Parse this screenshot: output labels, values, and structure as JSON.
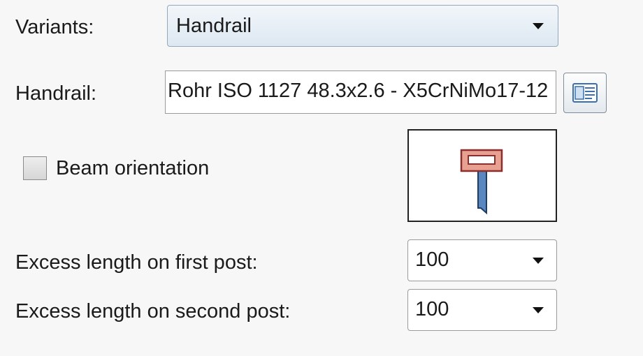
{
  "variants": {
    "label": "Variants:",
    "selected": "Handrail"
  },
  "handrail": {
    "label": "Handrail:",
    "value": "Rohr ISO 1127 48.3x2.6 - X5CrNiMo17-12",
    "browse_icon": "catalog-icon"
  },
  "beam_orientation": {
    "label": "Beam orientation",
    "checked": false
  },
  "preview": {
    "icon": "handrail-profile-icon"
  },
  "excess_first": {
    "label": "Excess length on first post:",
    "value": "100"
  },
  "excess_second": {
    "label": "Excess length on second post:",
    "value": "100"
  },
  "colors": {
    "profile_fill": "#e8a090",
    "profile_stroke": "#8a2e2e",
    "post_fill": "#5a87bd",
    "post_stroke": "#1d3d66"
  }
}
